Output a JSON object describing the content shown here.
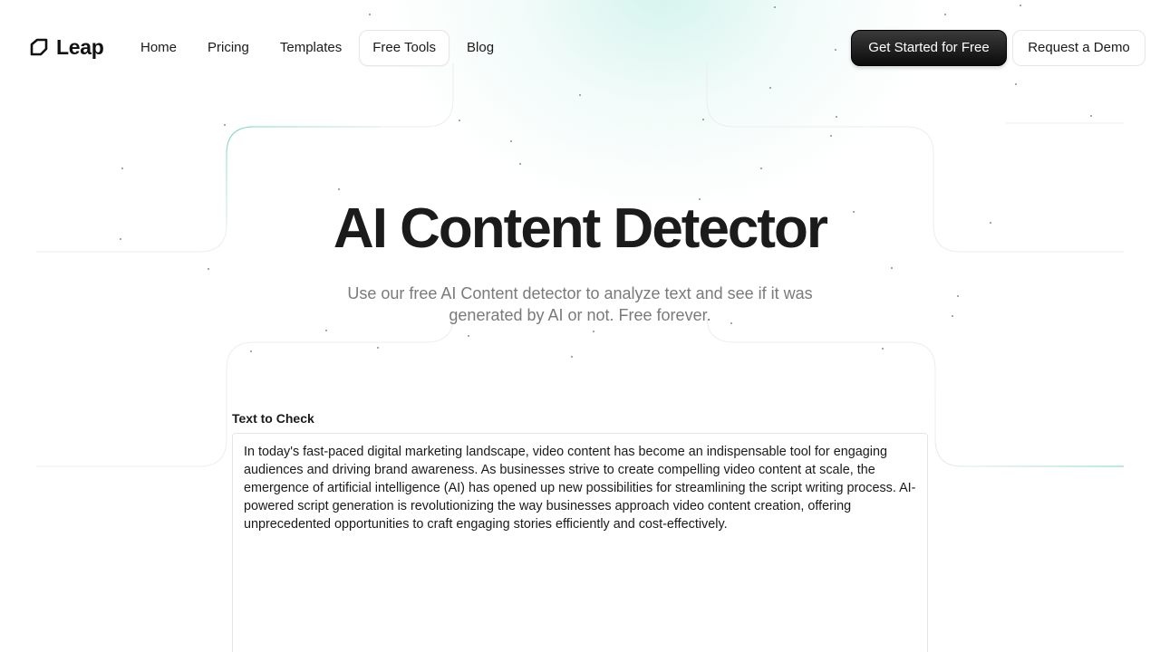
{
  "brand": {
    "name": "Leap",
    "logo_icon": "leap-logo-icon"
  },
  "nav": {
    "items": [
      {
        "label": "Home"
      },
      {
        "label": "Pricing"
      },
      {
        "label": "Templates"
      },
      {
        "label": "Free Tools",
        "active": true
      },
      {
        "label": "Blog"
      }
    ]
  },
  "actions": {
    "primary_label": "Get Started for Free",
    "secondary_label": "Request a Demo"
  },
  "hero": {
    "title": "AI Content Detector",
    "subtitle": "Use our free AI Content detector to analyze text and see if it was generated by AI or not. Free forever."
  },
  "form": {
    "label": "Text to Check",
    "value": "In today's fast-paced digital marketing landscape, video content has become an indispensable tool for engaging audiences and driving brand awareness. As businesses strive to create compelling video content at scale, the emergence of artificial intelligence (AI) has opened up new possibilities for streamlining the script writing process. AI-powered script generation is revolutionizing the way businesses approach video content creation, offering unprecedented opportunities to craft engaging stories efficiently and cost-effectively."
  },
  "colors": {
    "accent": "#5fd4b8",
    "primary_button": "#111111",
    "text": "#1a1a1a",
    "muted_text": "#7a7a7a"
  }
}
